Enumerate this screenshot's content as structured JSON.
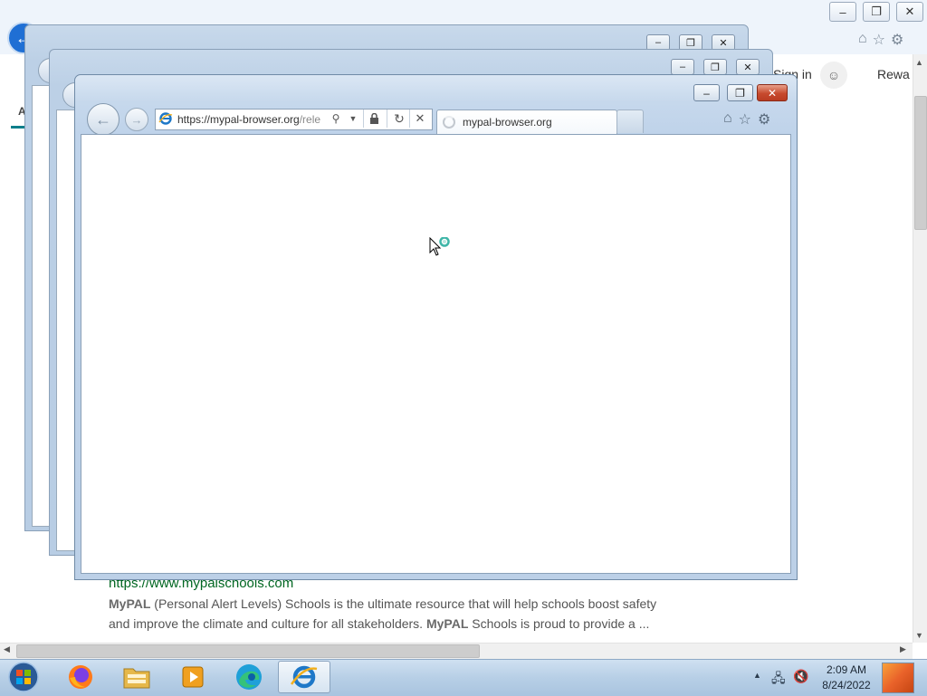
{
  "background_window": {
    "title_buttons": {
      "minimize": "–",
      "restore": "❐",
      "close": "✕"
    },
    "back_icon": "arrow-left-icon",
    "header": {
      "sign_in": "Sign in",
      "rewards": "Rewa"
    },
    "tab_letter": "A",
    "search_result": {
      "url": "https://www.mypalschools.com",
      "line1_bold": "MyPAL",
      "line1_rest": " (Personal Alert Levels) Schools is the ultimate resource that will help schools boost safety",
      "line2_start": "and improve the climate and culture for all stakeholders. ",
      "line2_bold": "MyPAL",
      "line2_rest": " Schools is proud to provide a ..."
    }
  },
  "popup_window": {
    "address": {
      "url_main": "https://mypal-browser.org",
      "url_dim": "/rele"
    },
    "tab": {
      "title": "mypal-browser.org"
    },
    "window_buttons": {
      "minimize": "–",
      "restore": "❐",
      "close": "✕"
    }
  },
  "taskbar": {
    "apps": [
      "start-orb",
      "firefox",
      "file-explorer",
      "media-player",
      "edge",
      "internet-explorer"
    ],
    "active_app": "internet-explorer",
    "clock": {
      "time": "2:09 AM",
      "date": "8/24/2022"
    }
  },
  "colors": {
    "accent_teal": "#0d7f8b",
    "result_url_green": "#006621",
    "close_red": "#c74a2e",
    "taskbar_blue": "#b7cfe6"
  }
}
